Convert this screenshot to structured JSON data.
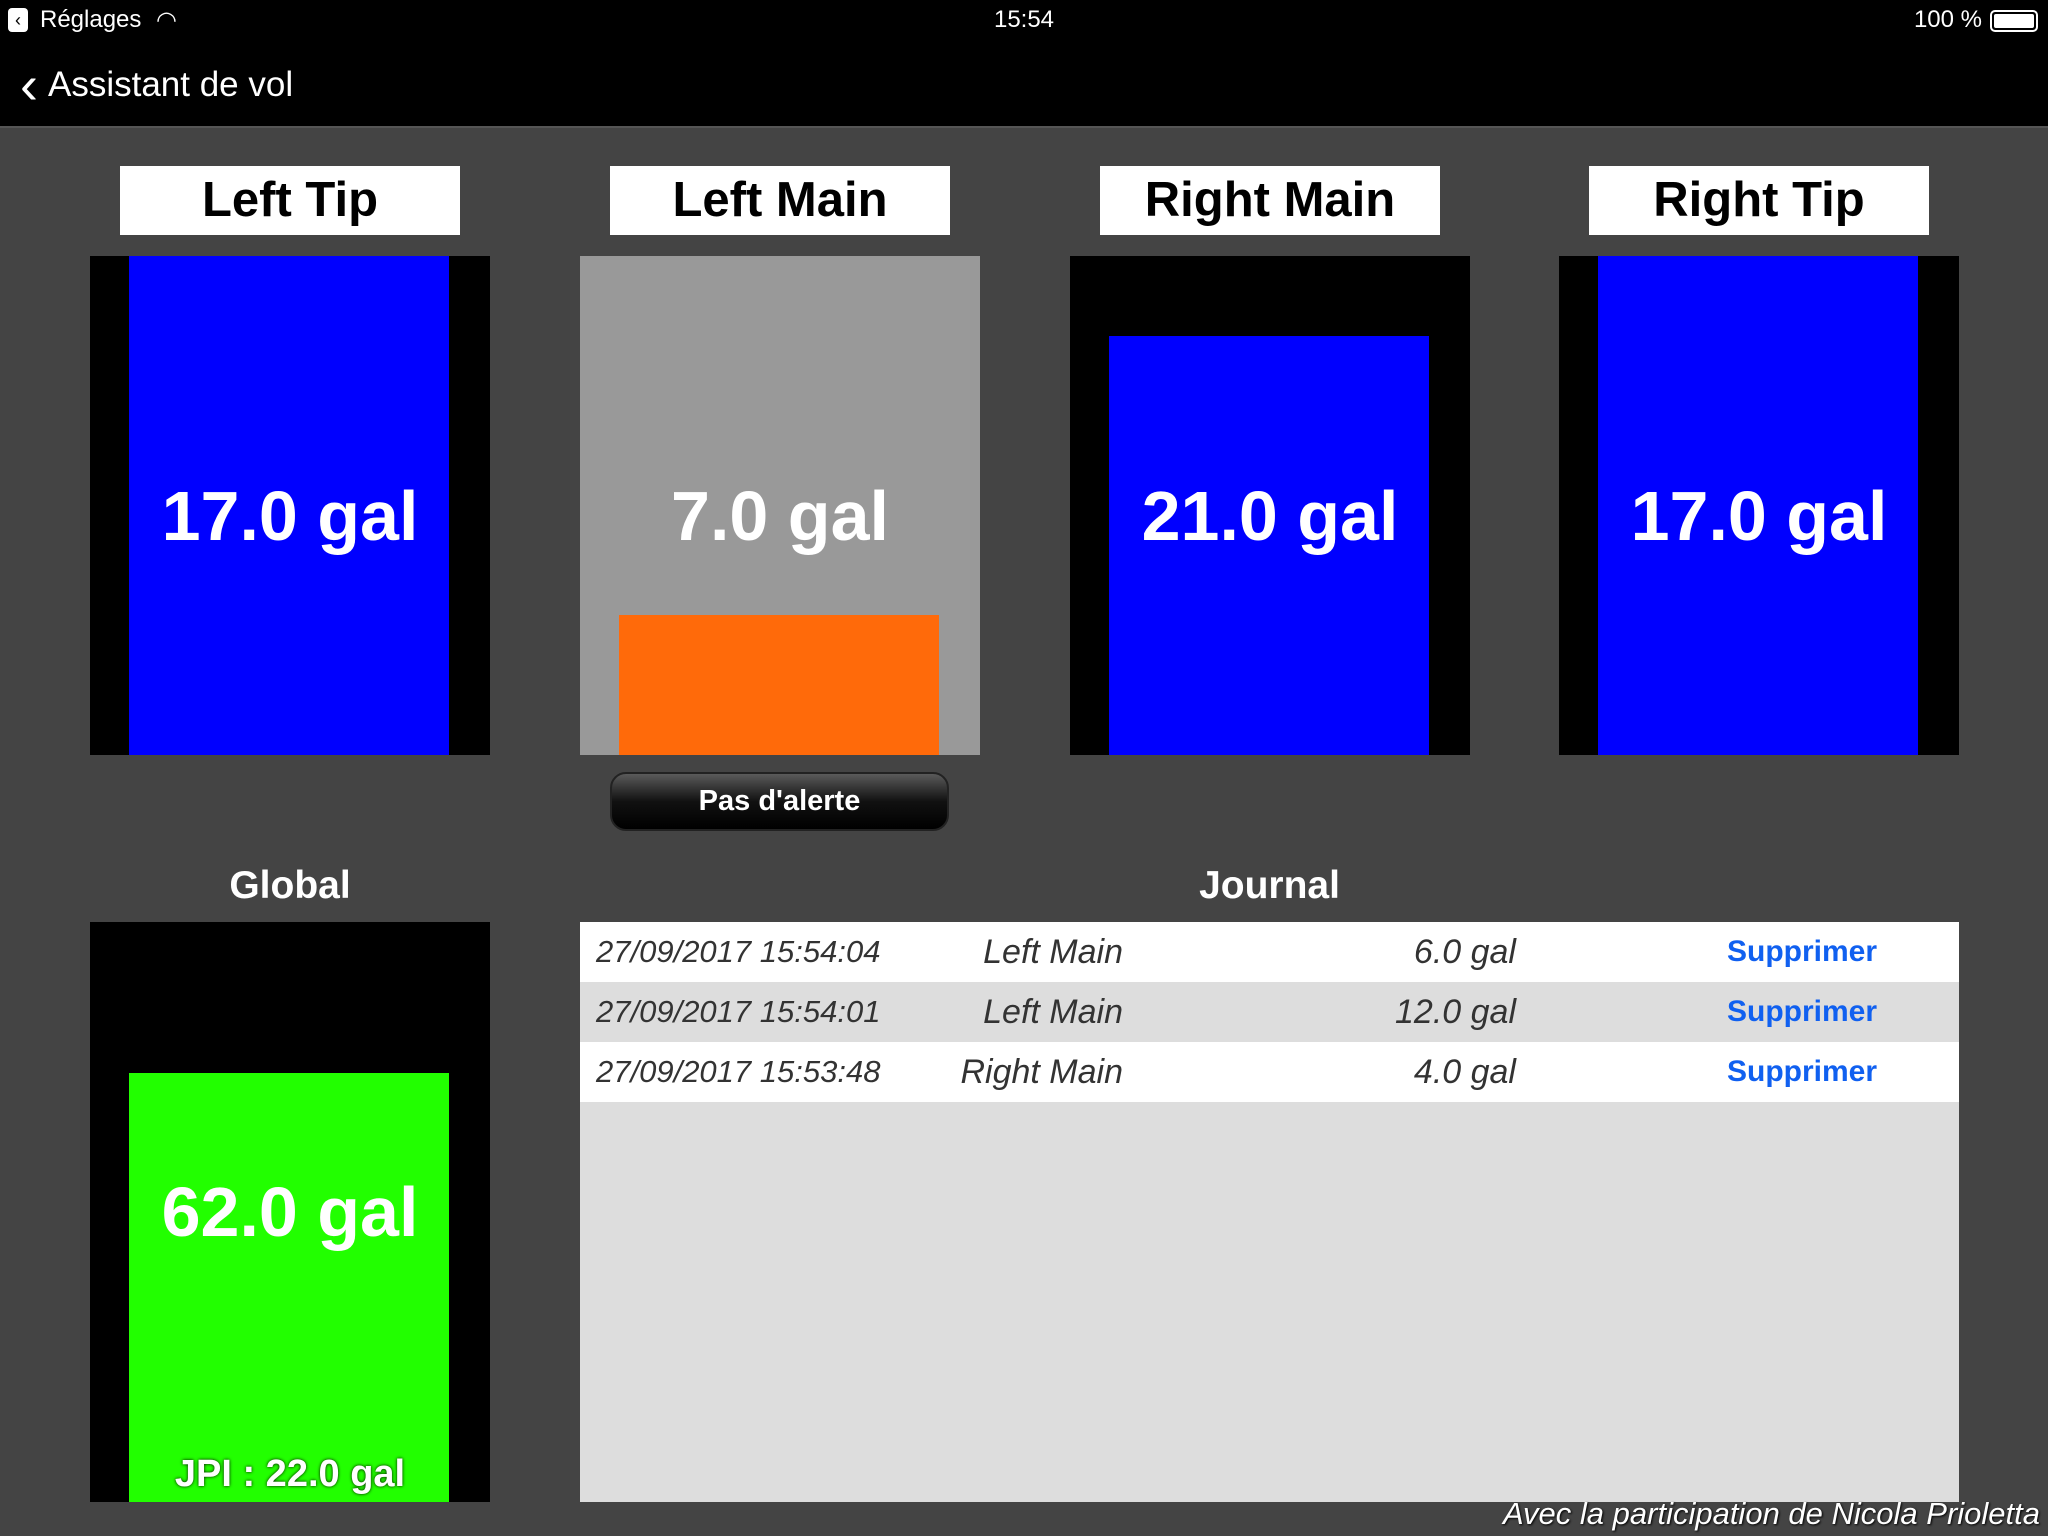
{
  "status_bar": {
    "back_app": "Réglages",
    "time": "15:54",
    "battery": "100 %"
  },
  "nav": {
    "back_label": "Assistant de vol"
  },
  "tanks": [
    {
      "name": "Left Tip",
      "value": "17.0 gal",
      "fill": 1.0,
      "color": "#0000ff",
      "background": "#000000"
    },
    {
      "name": "Left Main",
      "value": "7.0 gal",
      "fill": 0.28,
      "color": "#ff6a0a",
      "background": "#999999"
    },
    {
      "name": "Right Main",
      "value": "21.0 gal",
      "fill": 0.84,
      "color": "#0000ff",
      "background": "#000000"
    },
    {
      "name": "Right Tip",
      "value": "17.0 gal",
      "fill": 1.0,
      "color": "#0000ff",
      "background": "#000000"
    }
  ],
  "alert_button": "Pas d'alerte",
  "global": {
    "title": "Global",
    "value": "62.0 gal",
    "jpi": "JPI : 22.0 gal",
    "fill": 0.74,
    "color": "#22ff00"
  },
  "journal": {
    "title": "Journal",
    "rows": [
      {
        "datetime": "27/09/2017 15:54:04",
        "tank": "Left Main",
        "quantity": "6.0 gal",
        "action": "Supprimer"
      },
      {
        "datetime": "27/09/2017 15:54:01",
        "tank": "Left Main",
        "quantity": "12.0 gal",
        "action": "Supprimer"
      },
      {
        "datetime": "27/09/2017 15:53:48",
        "tank": "Right Main",
        "quantity": "4.0 gal",
        "action": "Supprimer"
      }
    ]
  },
  "footer": "Avec la participation de Nicola Prioletta"
}
